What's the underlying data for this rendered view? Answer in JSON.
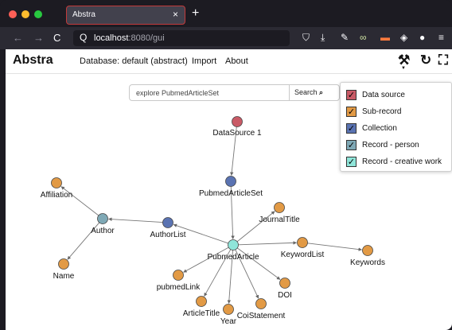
{
  "browser": {
    "tab_title": "Abstra",
    "tab_close": "×",
    "new_tab": "+",
    "url_host": "localhost",
    "url_rest": ":8080/gui",
    "back_icon": "←",
    "forward_icon": "→",
    "reload_icon": "C",
    "search_glyph": "Q",
    "toolbar_icons": [
      "shield-icon",
      "download-icon",
      "wrench-icon",
      "glasses-icon",
      "cookie-icon",
      "extension-icon",
      "eye-icon",
      "menu-icon"
    ]
  },
  "app": {
    "brand": "Abstra",
    "menu": [
      "Database: default (abstract)",
      "Import",
      "About"
    ]
  },
  "search": {
    "placeholder": "explore PubmedArticleSet",
    "button_label": "Search"
  },
  "legend": [
    {
      "label": "Data source",
      "color": "#c95a66",
      "check": "✓"
    },
    {
      "label": "Sub-record",
      "color": "#e29a45",
      "check": "✓"
    },
    {
      "label": "Collection",
      "color": "#5a73b2",
      "check": "✓"
    },
    {
      "label": "Record - person",
      "color": "#7fa9b6",
      "check": "✓"
    },
    {
      "label": "Record - creative work",
      "color": "#8fe5d9",
      "check": "✓"
    }
  ],
  "graph": {
    "nodes": [
      {
        "id": "DataSource 1",
        "type": "Data source"
      },
      {
        "id": "PubmedArticleSet",
        "type": "Collection"
      },
      {
        "id": "PubmedArticle",
        "type": "Record - creative work"
      },
      {
        "id": "AuthorList",
        "type": "Collection"
      },
      {
        "id": "Author",
        "type": "Record - person"
      },
      {
        "id": "Affiliation",
        "type": "Sub-record"
      },
      {
        "id": "Name",
        "type": "Sub-record"
      },
      {
        "id": "JournalTitle",
        "type": "Sub-record"
      },
      {
        "id": "KeywordList",
        "type": "Sub-record"
      },
      {
        "id": "Keywords",
        "type": "Sub-record"
      },
      {
        "id": "DOI",
        "type": "Sub-record"
      },
      {
        "id": "CoiStatement",
        "type": "Sub-record"
      },
      {
        "id": "Year",
        "type": "Sub-record"
      },
      {
        "id": "ArticleTitle",
        "type": "Sub-record"
      },
      {
        "id": "pubmedLink",
        "type": "Sub-record"
      }
    ],
    "edges": [
      [
        "DataSource 1",
        "PubmedArticleSet"
      ],
      [
        "PubmedArticleSet",
        "PubmedArticle"
      ],
      [
        "PubmedArticle",
        "AuthorList"
      ],
      [
        "AuthorList",
        "Author"
      ],
      [
        "Author",
        "Affiliation"
      ],
      [
        "Author",
        "Name"
      ],
      [
        "PubmedArticle",
        "JournalTitle"
      ],
      [
        "PubmedArticle",
        "KeywordList"
      ],
      [
        "KeywordList",
        "Keywords"
      ],
      [
        "PubmedArticle",
        "DOI"
      ],
      [
        "PubmedArticle",
        "CoiStatement"
      ],
      [
        "PubmedArticle",
        "Year"
      ],
      [
        "PubmedArticle",
        "ArticleTitle"
      ],
      [
        "PubmedArticle",
        "pubmedLink"
      ]
    ]
  }
}
